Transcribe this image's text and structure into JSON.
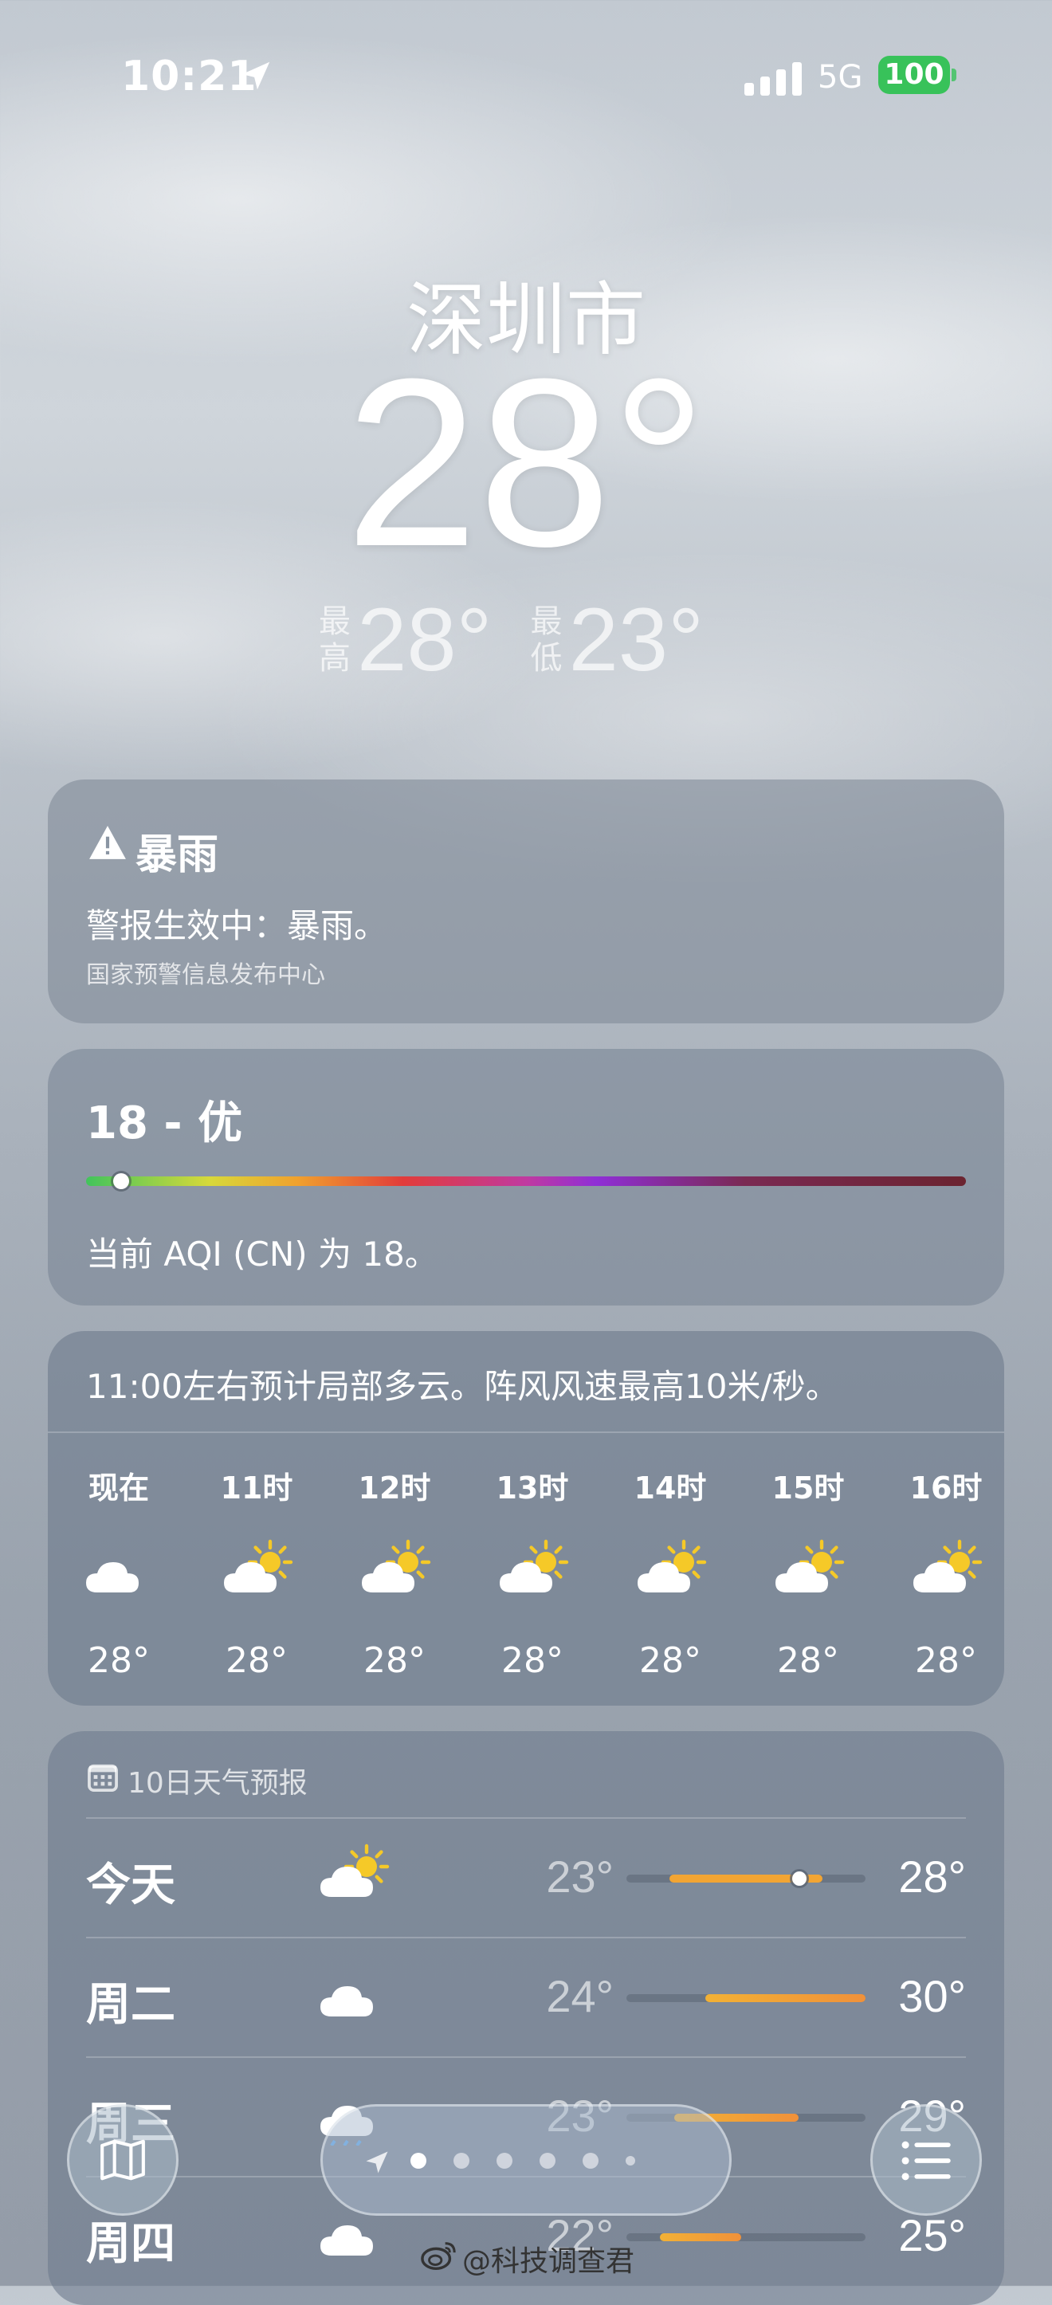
{
  "status": {
    "time": "10:21",
    "network": "5G",
    "battery": "100"
  },
  "header": {
    "city": "深圳市",
    "temperature": "28°",
    "high_label": "最高",
    "high": "28°",
    "low_label": "最低",
    "low": "23°"
  },
  "alert": {
    "title": "暴雨",
    "body": "警报生效中：暴雨。",
    "source": "国家预警信息发布中心"
  },
  "aqi": {
    "title": "18 - 优",
    "description": "当前 AQI (CN) 为 18。",
    "level_fraction": 0.04
  },
  "hourly": {
    "summary": "11:00左右预计局部多云。阵风风速最高10米/秒。",
    "items": [
      {
        "label": "现在",
        "icon": "cloud-icon",
        "temp": "28°"
      },
      {
        "label": "11时",
        "icon": "partly-sunny-icon",
        "temp": "28°"
      },
      {
        "label": "12时",
        "icon": "partly-sunny-icon",
        "temp": "28°"
      },
      {
        "label": "13时",
        "icon": "partly-sunny-icon",
        "temp": "28°"
      },
      {
        "label": "14时",
        "icon": "partly-sunny-icon",
        "temp": "28°"
      },
      {
        "label": "15时",
        "icon": "partly-sunny-icon",
        "temp": "28°"
      },
      {
        "label": "16时",
        "icon": "partly-sunny-icon",
        "temp": "28°"
      }
    ]
  },
  "forecast": {
    "heading": "10日天气预报",
    "days": [
      {
        "day": "今天",
        "icon": "partly-sunny-icon",
        "low": "23°",
        "high": "28°",
        "range_start": 0.18,
        "range_end": 0.82,
        "current": 0.72
      },
      {
        "day": "周二",
        "icon": "cloud-icon",
        "low": "24°",
        "high": "30°",
        "range_start": 0.33,
        "range_end": 1.0
      },
      {
        "day": "周三",
        "icon": "rain-cloud-icon",
        "low": "23°",
        "high": "29°",
        "range_start": 0.2,
        "range_end": 0.72
      },
      {
        "day": "周四",
        "icon": "cloud-icon",
        "low": "22°",
        "high": "25°",
        "range_start": 0.14,
        "range_end": 0.48
      }
    ]
  },
  "nav": {
    "page_count": 7,
    "active_page": 1
  },
  "watermark": "@科技调查君",
  "colors": {
    "battery": "#38c25a",
    "temp_bar_today": "#f2a533",
    "temp_bar_warm": "#f0913a"
  }
}
